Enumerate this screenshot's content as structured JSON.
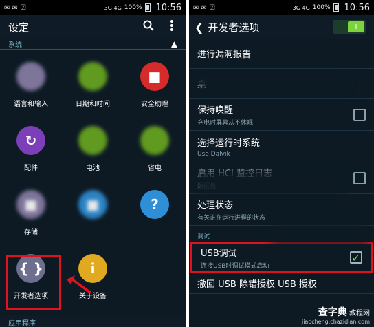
{
  "status": {
    "left_icons": "✉ ✉ ☑",
    "network": "3G 4G",
    "battery_pct": "100%",
    "time": "10:56"
  },
  "left": {
    "title": "设定",
    "section": "系统",
    "tiles": [
      {
        "label": "语言和输入",
        "color": "#8b7fa8",
        "icon": "keyboard-icon",
        "glyph": ""
      },
      {
        "label": "日期和时间",
        "color": "#6aa81f",
        "icon": "clock-icon",
        "glyph": ""
      },
      {
        "label": "安全助理",
        "color": "#d62b2b",
        "icon": "siren-icon",
        "glyph": "■"
      },
      {
        "label": "配件",
        "color": "#7d3fb8",
        "icon": "accessory-icon",
        "glyph": "↻"
      },
      {
        "label": "电池",
        "color": "#6aa81f",
        "icon": "battery-icon",
        "glyph": ""
      },
      {
        "label": "省电",
        "color": "#6aa81f",
        "icon": "power-saving-icon",
        "glyph": ""
      },
      {
        "label": "存储",
        "color": "#8b7fa8",
        "icon": "storage-icon",
        "glyph": "■"
      },
      {
        "label": "",
        "color": "#2f8fd6",
        "icon": "lock-icon",
        "glyph": "■"
      },
      {
        "label": "",
        "color": "#2f8fd6",
        "icon": "help-icon",
        "glyph": "?"
      },
      {
        "label": "开发者选项",
        "color": "#6e6e8e",
        "icon": "developer-options-icon",
        "glyph": "{ }"
      },
      {
        "label": "关于设备",
        "color": "#e0a91f",
        "icon": "about-device-icon",
        "glyph": "i"
      }
    ],
    "bottom_section": "应用程序"
  },
  "right": {
    "title": "开发者选项",
    "toggle_state": "I",
    "items": [
      {
        "title": "进行漏洞报告",
        "sub": "",
        "checkbox": "none"
      },
      {
        "title": "桌",
        "sub": "",
        "checkbox": "none"
      },
      {
        "title": "保持唤醒",
        "sub": "充电时屏幕从不休眠",
        "checkbox": "off"
      },
      {
        "title": "选择运行时系统",
        "sub": "Use Dalvik",
        "checkbox": "none"
      },
      {
        "title": "启用 HCI 监控日志",
        "sub": "数据包",
        "checkbox": "off"
      },
      {
        "title": "处理状态",
        "sub": "有关正在运行进程的状态",
        "checkbox": "none"
      }
    ],
    "category": "调试",
    "usb": {
      "title": "USB调试",
      "sub": "连接USB时调试模式启动",
      "check": "✓"
    },
    "revoke": "撤回 USB 除错授权 USB 授权",
    "watermark": {
      "a": "查字典",
      "b": "教程网",
      "c": "jiaocheng.chazidian.com"
    }
  }
}
